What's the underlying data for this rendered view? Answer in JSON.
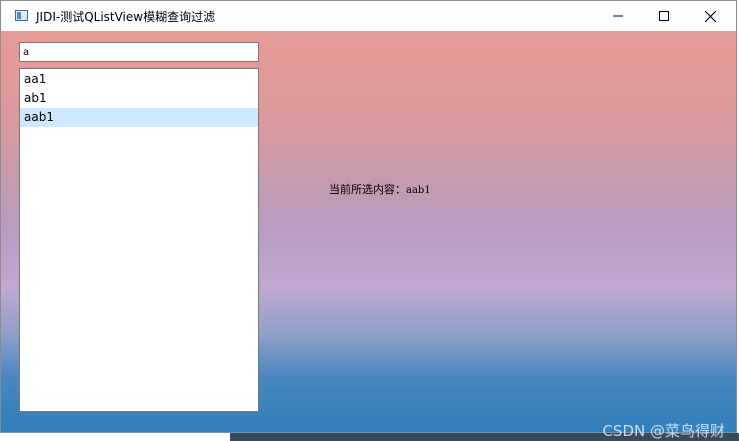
{
  "window": {
    "title": "JIDI-测试QListView模糊查询过滤",
    "icons": {
      "app": "app-window-icon",
      "minimize": "minimize-icon",
      "maximize": "maximize-icon",
      "close": "close-icon"
    }
  },
  "search": {
    "value": "a"
  },
  "list": {
    "items": [
      "aa1",
      "ab1",
      "aab1"
    ],
    "selected": "aab1",
    "selected_color": "#cde8ff"
  },
  "status": {
    "label": "当前所选内容：",
    "value": "aab1"
  },
  "watermark": "CSDN @菜鸟得财",
  "colors": {
    "gradient_top": "#e99a97",
    "gradient_mid": "#c0a8d0",
    "gradient_bottom": "#2f7fbc"
  }
}
